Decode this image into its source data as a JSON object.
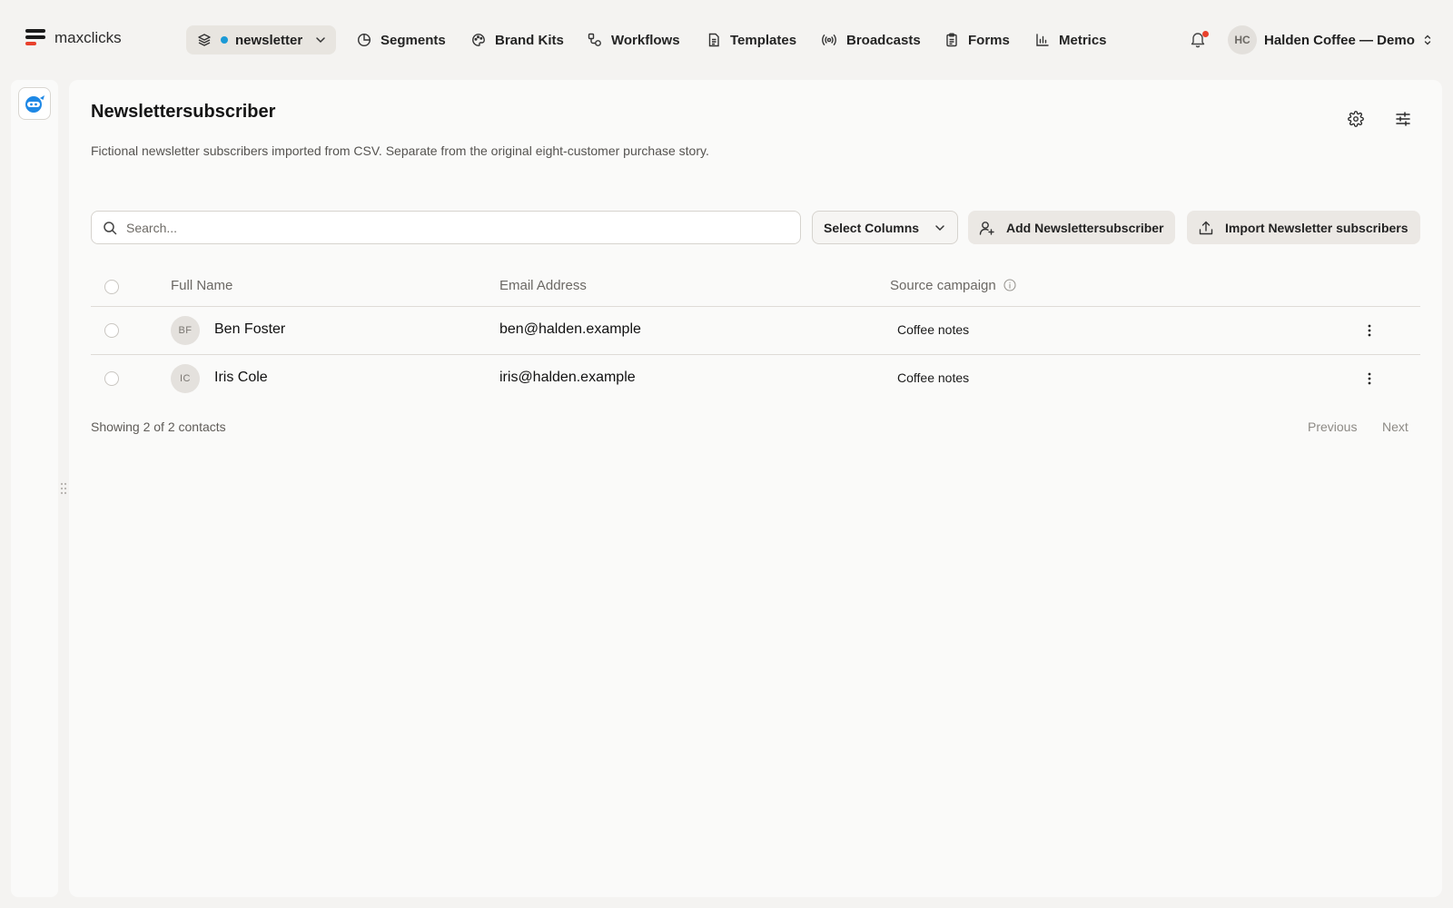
{
  "app": {
    "name": "maxclicks"
  },
  "workspace": {
    "label": "newsletter",
    "dot_color": "#1b9ad6"
  },
  "nav": {
    "items": [
      {
        "label": "Segments"
      },
      {
        "label": "Brand Kits"
      },
      {
        "label": "Workflows"
      },
      {
        "label": "Templates"
      },
      {
        "label": "Broadcasts"
      },
      {
        "label": "Forms"
      },
      {
        "label": "Metrics"
      }
    ]
  },
  "account": {
    "initials": "HC",
    "name": "Halden Coffee — Demo"
  },
  "notifications": {
    "badge_color": "#e8412c"
  },
  "page": {
    "title": "Newslettersubscriber",
    "description": "Fictional newsletter subscribers imported from CSV. Separate from the original eight-customer purchase story."
  },
  "toolbar": {
    "search_placeholder": "Search...",
    "select_columns": "Select Columns",
    "add_button": "Add Newslettersubscriber",
    "import_button": "Import Newsletter subscribers"
  },
  "table": {
    "columns": [
      "Full Name",
      "Email Address",
      "Source campaign"
    ],
    "rows": [
      {
        "initials": "BF",
        "name": "Ben Foster",
        "email": "ben@halden.example",
        "source": "Coffee notes"
      },
      {
        "initials": "IC",
        "name": "Iris Cole",
        "email": "iris@halden.example",
        "source": "Coffee notes"
      }
    ]
  },
  "footer": {
    "count_text": "Showing 2 of 2 contacts",
    "previous": "Previous",
    "next": "Next"
  }
}
